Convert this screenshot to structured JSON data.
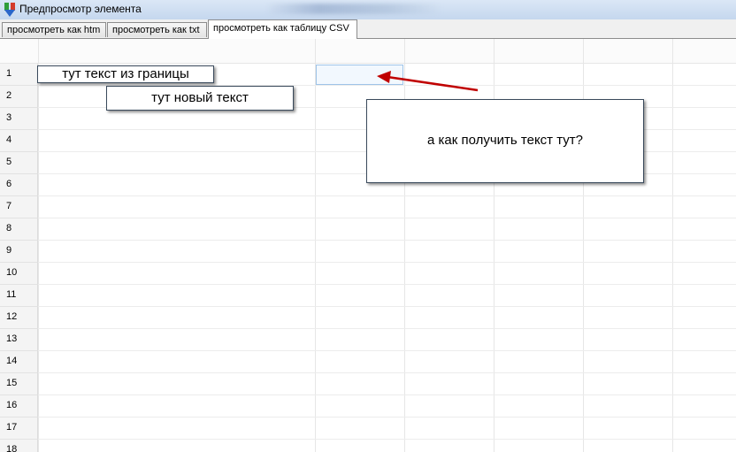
{
  "window": {
    "title": "Предпросмотр элемента"
  },
  "tabs": [
    {
      "label": "просмотреть как htm"
    },
    {
      "label": "просмотреть как txt"
    },
    {
      "label": "просмотреть как таблицу CSV"
    }
  ],
  "grid": {
    "row_numbers": [
      "1",
      "2",
      "3",
      "4",
      "5",
      "6",
      "7",
      "8",
      "9",
      "10",
      "11",
      "12",
      "13",
      "14",
      "15",
      "16",
      "17",
      "18"
    ],
    "selected_cell": {
      "row": "1",
      "column": 2
    }
  },
  "annotations": {
    "border_text": "тут текст из границы",
    "new_text": "тут новый текст",
    "question": "а как получить текст тут?"
  },
  "colors": {
    "arrow": "#c00000",
    "selection": "#9fc4e8"
  }
}
